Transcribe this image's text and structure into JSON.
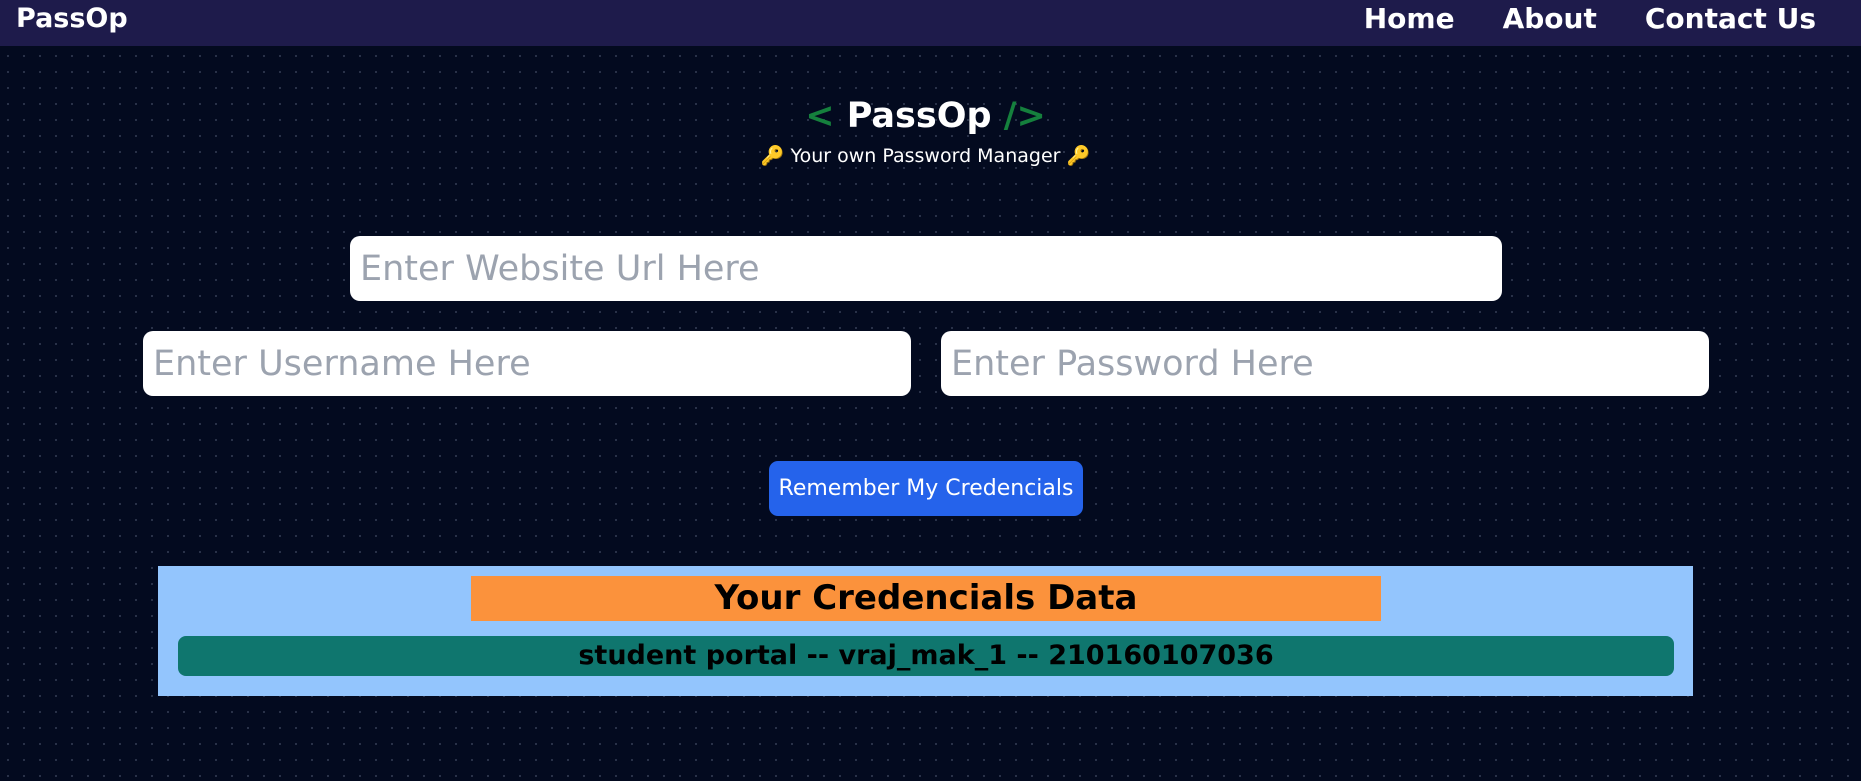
{
  "navbar": {
    "brand": "PassOp",
    "links": [
      "Home",
      "About",
      "Contact Us"
    ]
  },
  "header": {
    "logo_open": "<",
    "logo_word": "PassOp",
    "logo_close": "/>",
    "tagline": "Your own Password Manager",
    "tagline_icon": "key-icon"
  },
  "form": {
    "url_placeholder": "Enter Website Url Here",
    "username_placeholder": "Enter Username Here",
    "password_placeholder": "Enter Password Here",
    "save_label": "Remember My Credencials"
  },
  "credentials": {
    "heading": "Your Credencials Data",
    "rows": [
      "student portal -- vraj_mak_1 -- 210160107036"
    ]
  },
  "colors": {
    "background": "#030a1f",
    "navbar": "#1e1b4b",
    "accent_green": "#15803d",
    "button_blue": "#2563eb",
    "panel_blue": "#93c5fd",
    "heading_orange": "#fb923c",
    "row_teal": "#0f766e"
  }
}
